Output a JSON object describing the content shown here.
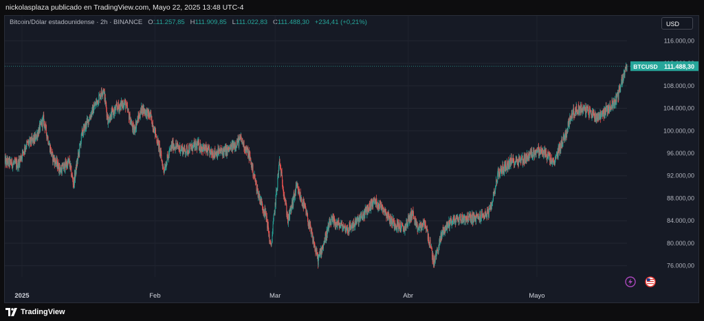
{
  "header": {
    "text": "nickolasplaza publicado en TradingView.com, Mayo 22, 2025 13:48 UTC-4"
  },
  "legend": {
    "symbol": "Bitcoin/Dólar estadounidense · 2h · BINANCE",
    "open_label": "O",
    "open_value": "111.257,85",
    "high_label": "H",
    "high_value": "111.909,85",
    "low_label": "L",
    "low_value": "111.022,83",
    "close_label": "C",
    "close_value": "111.488,30",
    "change": "+234,41 (+0,21%)"
  },
  "currency_button": "USD",
  "price_tag": {
    "symbol": "BTCUSD",
    "value": "111.488,30"
  },
  "footer": {
    "brand": "TradingView"
  },
  "icons": [
    "lightning-icon",
    "us-flag-icon",
    "tradingview-logo-icon"
  ],
  "colors": {
    "up": "#26a69a",
    "down": "#ef5350",
    "background": "#161a25",
    "accent": "#8e24aa"
  },
  "chart_data": {
    "type": "candlestick",
    "title": "",
    "xlabel": "",
    "ylabel": "",
    "ylim": [
      74000,
      118000
    ],
    "y_ticks": [
      "116.000,00",
      "112.000,00",
      "108.000,00",
      "104.000,00",
      "100.000,00",
      "96.000,00",
      "92.000,00",
      "88.000,00",
      "84.000,00",
      "80.000,00",
      "76.000,00"
    ],
    "y_tick_values": [
      116000,
      112000,
      108000,
      104000,
      100000,
      96000,
      92000,
      88000,
      84000,
      80000,
      76000
    ],
    "x_tick_labels": [
      "2025",
      "Feb",
      "Mar",
      "Abr",
      "Mayo"
    ],
    "x_tick_dates": [
      "2025-01-01",
      "2025-02-01",
      "2025-03-01",
      "2025-04-01",
      "2025-05-01"
    ],
    "date_range": [
      "2024-12-28",
      "2025-05-22"
    ],
    "last_price": 111488.3,
    "price_path": [
      [
        "2024-12-28",
        94500
      ],
      [
        "2024-12-31",
        94000
      ],
      [
        "2025-01-02",
        97500
      ],
      [
        "2025-01-04",
        98500
      ],
      [
        "2025-01-06",
        102000
      ],
      [
        "2025-01-08",
        95500
      ],
      [
        "2025-01-10",
        93000
      ],
      [
        "2025-01-12",
        94500
      ],
      [
        "2025-01-13",
        90500
      ],
      [
        "2025-01-15",
        99500
      ],
      [
        "2025-01-18",
        104500
      ],
      [
        "2025-01-20",
        107500
      ],
      [
        "2025-01-21",
        102000
      ],
      [
        "2025-01-23",
        104000
      ],
      [
        "2025-01-25",
        105000
      ],
      [
        "2025-01-27",
        100000
      ],
      [
        "2025-01-29",
        104000
      ],
      [
        "2025-01-31",
        102500
      ],
      [
        "2025-02-02",
        97000
      ],
      [
        "2025-02-03",
        93000
      ],
      [
        "2025-02-05",
        97500
      ],
      [
        "2025-02-08",
        96500
      ],
      [
        "2025-02-11",
        97500
      ],
      [
        "2025-02-14",
        96000
      ],
      [
        "2025-02-18",
        96500
      ],
      [
        "2025-02-21",
        98500
      ],
      [
        "2025-02-23",
        95500
      ],
      [
        "2025-02-25",
        89000
      ],
      [
        "2025-02-27",
        84500
      ],
      [
        "2025-02-28",
        79000
      ],
      [
        "2025-03-02",
        94500
      ],
      [
        "2025-03-04",
        84000
      ],
      [
        "2025-03-06",
        90000
      ],
      [
        "2025-03-08",
        86000
      ],
      [
        "2025-03-10",
        80000
      ],
      [
        "2025-03-11",
        77000
      ],
      [
        "2025-03-14",
        84000
      ],
      [
        "2025-03-18",
        82500
      ],
      [
        "2025-03-21",
        84500
      ],
      [
        "2025-03-24",
        87500
      ],
      [
        "2025-03-26",
        86500
      ],
      [
        "2025-03-28",
        84000
      ],
      [
        "2025-03-31",
        82500
      ],
      [
        "2025-04-02",
        85500
      ],
      [
        "2025-04-03",
        82500
      ],
      [
        "2025-04-05",
        83500
      ],
      [
        "2025-04-07",
        76500
      ],
      [
        "2025-04-09",
        82000
      ],
      [
        "2025-04-11",
        84000
      ],
      [
        "2025-04-14",
        84500
      ],
      [
        "2025-04-17",
        84500
      ],
      [
        "2025-04-20",
        85500
      ],
      [
        "2025-04-22",
        92500
      ],
      [
        "2025-04-25",
        94500
      ],
      [
        "2025-04-28",
        95000
      ],
      [
        "2025-05-01",
        96500
      ],
      [
        "2025-05-03",
        96000
      ],
      [
        "2025-05-05",
        94000
      ],
      [
        "2025-05-06",
        96500
      ],
      [
        "2025-05-08",
        100000
      ],
      [
        "2025-05-09",
        103000
      ],
      [
        "2025-05-11",
        104000
      ],
      [
        "2025-05-13",
        103500
      ],
      [
        "2025-05-15",
        102500
      ],
      [
        "2025-05-17",
        103500
      ],
      [
        "2025-05-19",
        105000
      ],
      [
        "2025-05-20",
        106500
      ],
      [
        "2025-05-21",
        109500
      ],
      [
        "2025-05-22",
        111488.3
      ]
    ]
  }
}
